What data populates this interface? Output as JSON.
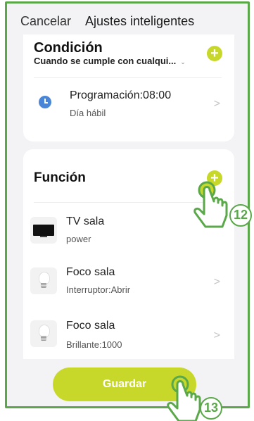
{
  "header": {
    "cancel_label": "Cancelar",
    "title": "Ajustes inteligentes"
  },
  "condition": {
    "title": "Condición",
    "subtitle": "Cuando se cumple con cualqui...",
    "caret": "⌄",
    "schedule": {
      "title": "Programación:08:00",
      "subtitle": "Día hábil"
    }
  },
  "function": {
    "title": "Función",
    "devices": [
      {
        "name": "TV sala",
        "action": "power",
        "icon": "tv-icon"
      },
      {
        "name": "Foco sala",
        "action": "Interruptor:Abrir",
        "icon": "bulb-icon"
      },
      {
        "name": "Foco sala",
        "action": "Brillante:1000",
        "icon": "bulb-icon"
      }
    ]
  },
  "footer": {
    "save_label": "Guardar"
  },
  "annotations": {
    "step_12": "12",
    "step_13": "13"
  },
  "colors": {
    "accent": "#c8d82a",
    "frame": "#5aa84a",
    "clock": "#4a86d8"
  }
}
